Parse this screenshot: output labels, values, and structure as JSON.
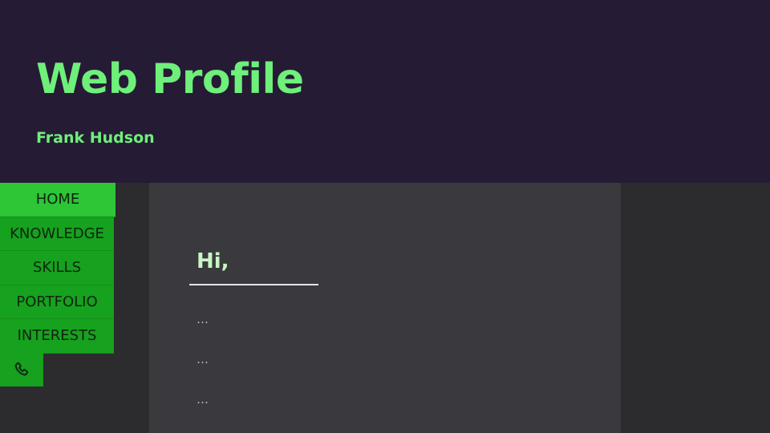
{
  "header": {
    "title": "Web Profile",
    "subtitle": "Frank Hudson"
  },
  "nav": {
    "items": [
      {
        "label": "HOME",
        "active": true
      },
      {
        "label": "KNOWLEDGE",
        "active": false
      },
      {
        "label": "SKILLS",
        "active": false
      },
      {
        "label": "PORTFOLIO",
        "active": false
      },
      {
        "label": "INTERESTS",
        "active": false
      }
    ],
    "contact_icon": "phone-icon"
  },
  "main": {
    "greeting": "Hi,",
    "lines": [
      "…",
      "…",
      "…"
    ]
  },
  "colors": {
    "header_bg": "#261b35",
    "accent_text": "#6ef07a",
    "nav_bg": "#16a11e",
    "nav_active_bg": "#2ec537",
    "content_bg": "#3a393d",
    "page_bg": "#2c2b2e"
  }
}
